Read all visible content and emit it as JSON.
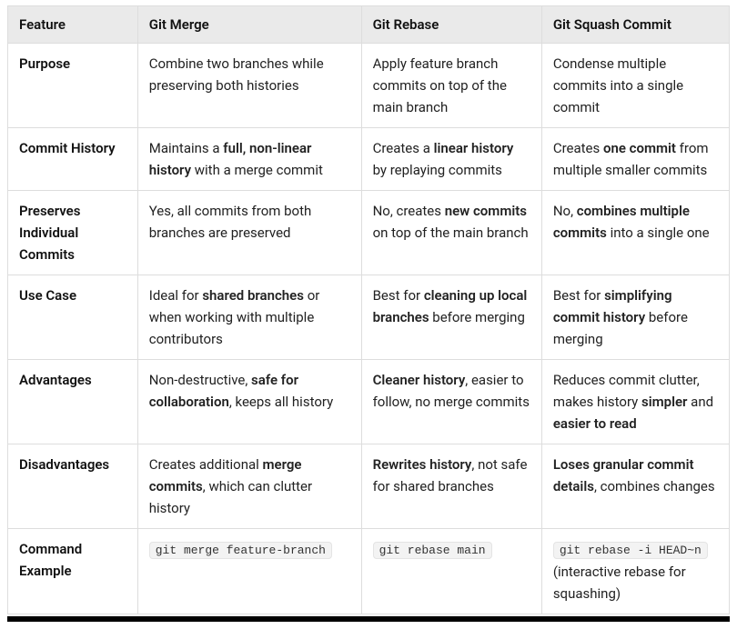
{
  "chart_data": {
    "type": "table",
    "headers": [
      "Feature",
      "Git Merge",
      "Git Rebase",
      "Git Squash Commit"
    ],
    "rows": [
      {
        "feature": "Purpose",
        "merge": "Combine two branches while preserving both histories",
        "rebase": "Apply feature branch commits on top of the main branch",
        "squash": "Condense multiple commits into a single commit"
      },
      {
        "feature": "Commit History",
        "merge": "Maintains a <b>full, non-linear history</b> with a merge commit",
        "rebase": "Creates a <b>linear history</b> by replaying commits",
        "squash": "Creates <b>one commit</b> from multiple smaller commits"
      },
      {
        "feature": "Preserves Individual Commits",
        "merge": "Yes, all commits from both branches are preserved",
        "rebase": "No, creates <b>new commits</b> on top of the main branch",
        "squash": "No, <b>combines multiple commits</b> into a single one"
      },
      {
        "feature": "Use Case",
        "merge": "Ideal for <b>shared branches</b> or when working with multiple contributors",
        "rebase": "Best for <b>cleaning up local branches</b> before merging",
        "squash": "Best for <b>simplifying commit history</b> before merging"
      },
      {
        "feature": "Advantages",
        "merge": "Non-destructive, <b>safe for collaboration</b>, keeps all history",
        "rebase": "<b>Cleaner history</b>, easier to follow, no merge commits",
        "squash": "Reduces commit clutter, makes history <b>simpler</b> and <b>easier to read</b>"
      },
      {
        "feature": "Disadvantages",
        "merge": "Creates additional <b>merge commits</b>, which can clutter history",
        "rebase": "<b>Rewrites history</b>, not safe for shared branches",
        "squash": "<b>Loses granular commit details</b>, combines changes"
      },
      {
        "feature": "Command Example",
        "merge": "<code>git merge feature-branch</code>",
        "rebase": "<code>git rebase main</code>",
        "squash": "<code>git rebase -i HEAD~n</code> (interactive rebase for squashing)"
      }
    ]
  }
}
